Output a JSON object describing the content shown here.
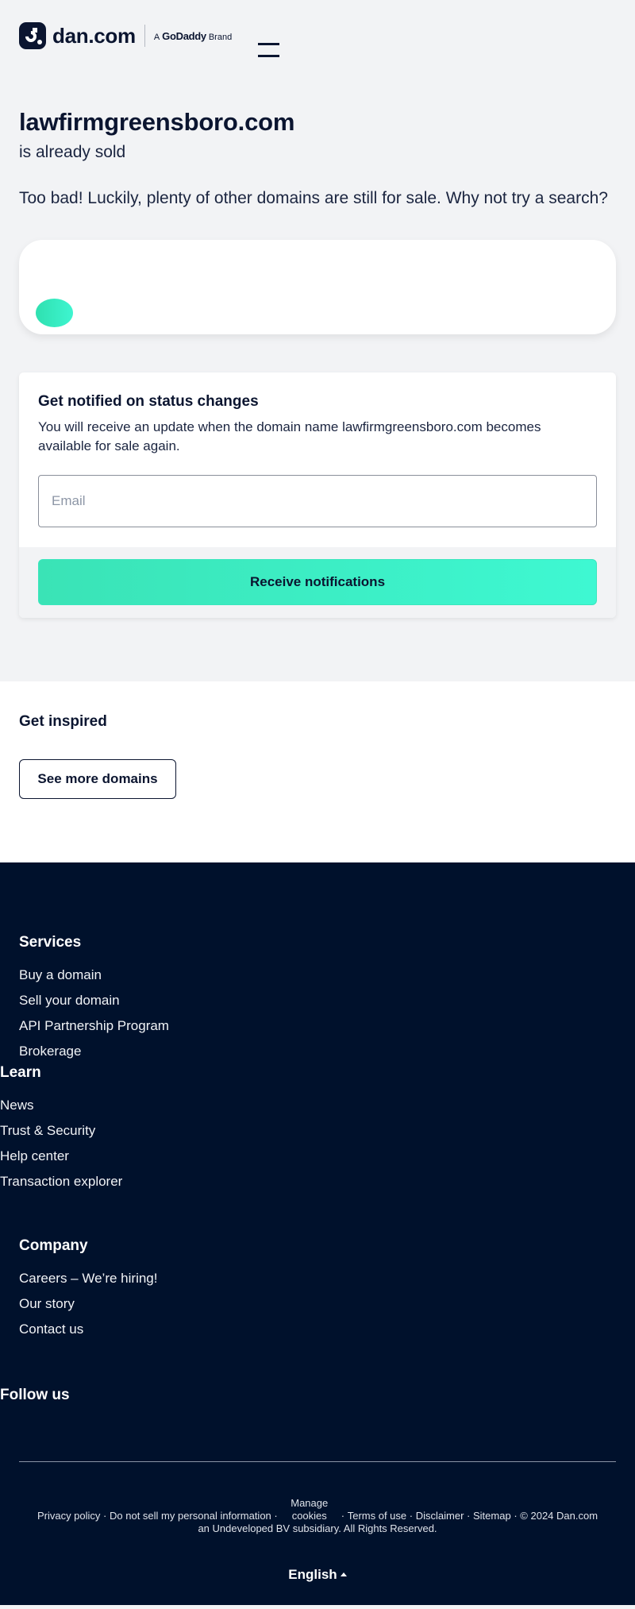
{
  "header": {
    "logo_text": "dan.com",
    "brand_prefix": "A",
    "brand_name": "GoDaddy",
    "brand_suffix": "Brand",
    "menu_icon": "hamburger-icon"
  },
  "hero": {
    "domain": "lawfirmgreensboro.com",
    "status": "is already sold",
    "message": "Too bad! Luckily, plenty of other domains are still for sale. Why not try a search?"
  },
  "search": {
    "button_icon": "search-icon"
  },
  "notify": {
    "title": "Get notified on status changes",
    "description": "You will receive an update when the domain name lawfirmgreensboro.com becomes available for sale again.",
    "email_placeholder": "Email",
    "email_value": "",
    "button_label": "Receive notifications"
  },
  "inspired": {
    "title": "Get inspired",
    "button_label": "See more domains"
  },
  "footer": {
    "columns": [
      {
        "title": "Services",
        "links": [
          "Buy a domain",
          "Sell your domain",
          "API Partnership Program",
          "Brokerage"
        ]
      },
      {
        "title": "Learn",
        "links": [
          "News",
          "Trust & Security",
          "Help center",
          "Transaction explorer"
        ]
      },
      {
        "title": "Company",
        "links": [
          "Careers – We’re hiring!",
          "Our story",
          "Contact us"
        ]
      }
    ],
    "follow_title": "Follow us",
    "legal": {
      "privacy": "Privacy policy",
      "do_not_sell": "Do not sell my personal information",
      "manage_cookies": "Manage cookies",
      "terms": "Terms of use",
      "disclaimer": "Disclaimer",
      "sitemap": "Sitemap",
      "copyright": "© 2024 Dan.com",
      "subsidiary": "an Undeveloped BV subsidiary. All Rights Reserved.",
      "separator": "·"
    },
    "language": "English"
  },
  "colors": {
    "brand_dark": "#0b1530",
    "footer_bg": "#00112c",
    "accent_start": "#3ae3b6",
    "accent_end": "#3ef8d2",
    "page_bg": "#f2f3f5"
  }
}
